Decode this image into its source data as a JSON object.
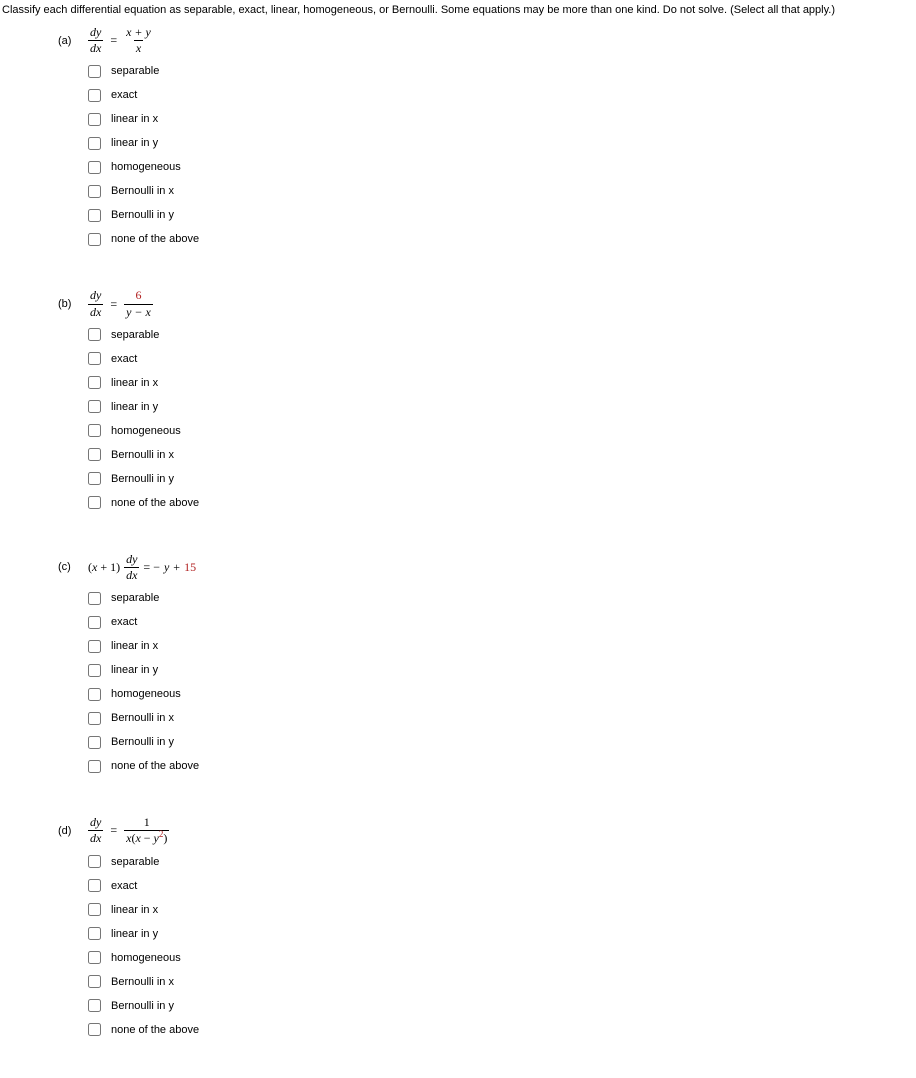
{
  "instructions": "Classify each differential equation as separable, exact, linear, homogeneous, or Bernoulli. Some equations may be more than one kind. Do not solve. (Select all that apply.)",
  "options": [
    "separable",
    "exact",
    "linear in x",
    "linear in y",
    "homogeneous",
    "Bernoulli in x",
    "Bernoulli in y",
    "none of the above"
  ],
  "problems": {
    "a": {
      "label": "(a)",
      "eq": {
        "lhs_num": "dy",
        "lhs_den": "dx",
        "op": "=",
        "rhs_num": "x + y",
        "rhs_den": "x"
      }
    },
    "b": {
      "label": "(b)",
      "eq": {
        "lhs_num": "dy",
        "lhs_den": "dx",
        "op": "=",
        "rhs_num": "6",
        "rhs_den": "y − x"
      }
    },
    "c": {
      "label": "(c)",
      "eq": {
        "pre_factor_open": "(",
        "pre_x": "x",
        "pre_plus": " + 1)",
        "frac_num": "dy",
        "frac_den": "dx",
        "op": "= −",
        "rhs_y": "y",
        "rhs_plus": " + ",
        "rhs_const": "15"
      }
    },
    "d": {
      "label": "(d)",
      "eq": {
        "lhs_num": "dy",
        "lhs_den": "dx",
        "op": "=",
        "rhs_num": "1",
        "rhs_den_x1": "x",
        "rhs_den_open": "(",
        "rhs_den_x2": "x",
        "rhs_den_minus": " − ",
        "rhs_den_y": "y",
        "rhs_den_exp": "2",
        "rhs_den_close": ")"
      }
    }
  }
}
